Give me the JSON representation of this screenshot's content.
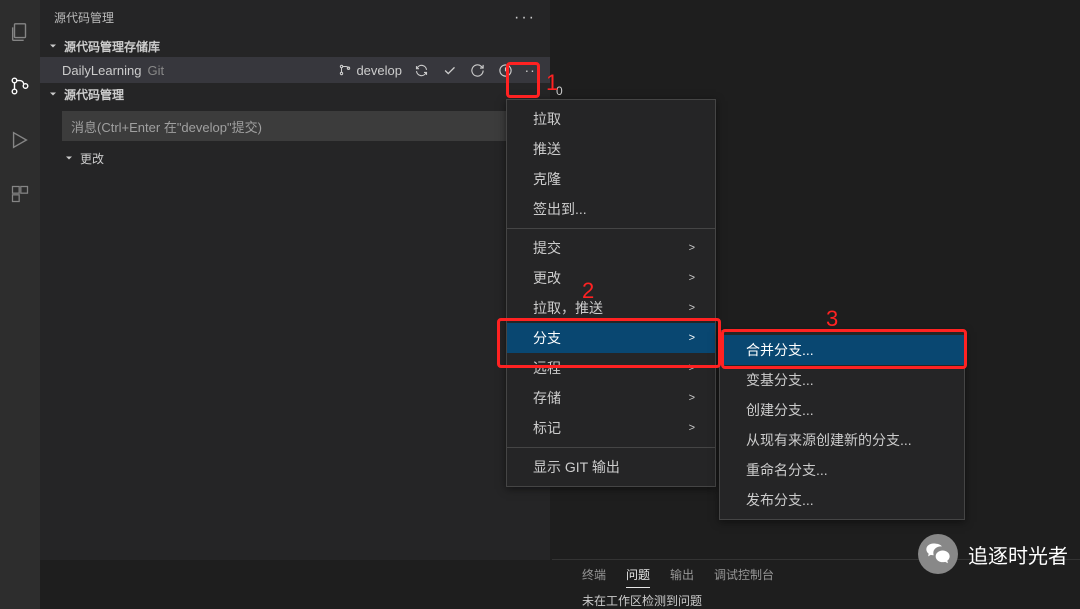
{
  "panel": {
    "title": "源代码管理",
    "repo_section": "源代码管理存储库",
    "scm_section": "源代码管理",
    "changes_section": "更改"
  },
  "repo": {
    "name": "DailyLearning",
    "type": "Git",
    "branch": "develop",
    "count": "0"
  },
  "input": {
    "placeholder": "消息(Ctrl+Enter 在\"develop\"提交)"
  },
  "menu1": {
    "items": [
      {
        "label": "拉取",
        "sub": false
      },
      {
        "label": "推送",
        "sub": false
      },
      {
        "label": "克隆",
        "sub": false
      },
      {
        "label": "签出到...",
        "sub": false
      },
      {
        "sep": true
      },
      {
        "label": "提交",
        "sub": true
      },
      {
        "label": "更改",
        "sub": true
      },
      {
        "label": "拉取，推送",
        "sub": true
      },
      {
        "label": "分支",
        "sub": true,
        "hover": true
      },
      {
        "label": "远程",
        "sub": true
      },
      {
        "label": "存储",
        "sub": true
      },
      {
        "label": "标记",
        "sub": true
      },
      {
        "sep": true
      },
      {
        "label": "显示 GIT 输出",
        "sub": false
      }
    ]
  },
  "menu2": {
    "items": [
      {
        "label": "合并分支...",
        "hover": true
      },
      {
        "label": "变基分支...",
        "hover": false
      },
      {
        "label": "创建分支...",
        "hover": false
      },
      {
        "label": "从现有来源创建新的分支...",
        "hover": false
      },
      {
        "label": "重命名分支...",
        "hover": false
      },
      {
        "label": "发布分支...",
        "hover": false
      }
    ]
  },
  "annotations": {
    "n1": "1",
    "n2": "2",
    "n3": "3"
  },
  "bottom": {
    "tabs": [
      "终端",
      "问题",
      "输出",
      "调试控制台"
    ],
    "active": 1,
    "text": "未在工作区检测到问题"
  },
  "watermark": "追逐时光者"
}
